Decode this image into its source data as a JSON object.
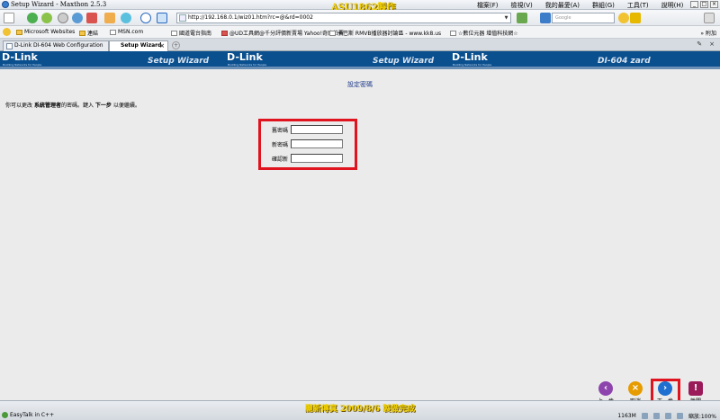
{
  "window": {
    "title": "Setup Wizard - Maxthon 2.5.3",
    "watermark": "ASU1862製作",
    "menus": [
      "檔案(F)",
      "檢視(V)",
      "我的最愛(A)",
      "群組(G)",
      "工具(T)",
      "說明(H)"
    ]
  },
  "toolbar": {
    "address": "http://192.168.0.1/wiz01.htm?rc=@&rd=0002",
    "search_placeholder": "Google"
  },
  "favorites": {
    "items": [
      "Microsoft Websites",
      "連結",
      "MSN.com",
      "國道電台指南",
      "@UD工具網@千分評價新賣場 Yahoo!奇摩拍賣",
      "卡巴斯 RMVB播放器討論區 - www.kk8.us",
      "☆數位元器 增值科技網☆"
    ],
    "add_label": "附加"
  },
  "tabs": [
    {
      "label": "D-Link DI-604 Web Configuration"
    },
    {
      "label": "Setup Wizard"
    }
  ],
  "banner": {
    "brand": "D-Link",
    "tagline": "Building Networks for People",
    "title": "Setup Wizard",
    "title_partial": "DI-604 zard"
  },
  "page": {
    "heading": "設定密碼",
    "instruction_prefix": "你可以更改",
    "instruction_bold": "系統管理者",
    "instruction_mid": "的密碼。鍵入",
    "instruction_bold2": "下一步",
    "instruction_suffix": "以便繼續。",
    "fields": [
      {
        "label": "舊密碼"
      },
      {
        "label": "新密碼"
      },
      {
        "label": "確認新"
      }
    ]
  },
  "wizard": {
    "prev_label": "上一步",
    "cancel_label": "取消",
    "next_label": "下一步",
    "exit_label": "離開"
  },
  "status": {
    "credit": "麗新傳真 2009/8/6 製做完成",
    "left": "EasyTalk in C++",
    "memory": "1163M",
    "zoom": "縮放:100%"
  },
  "colors": {
    "banner": "#0a4f8e",
    "highlight": "#e0141e",
    "watermark": "#f0d000"
  }
}
